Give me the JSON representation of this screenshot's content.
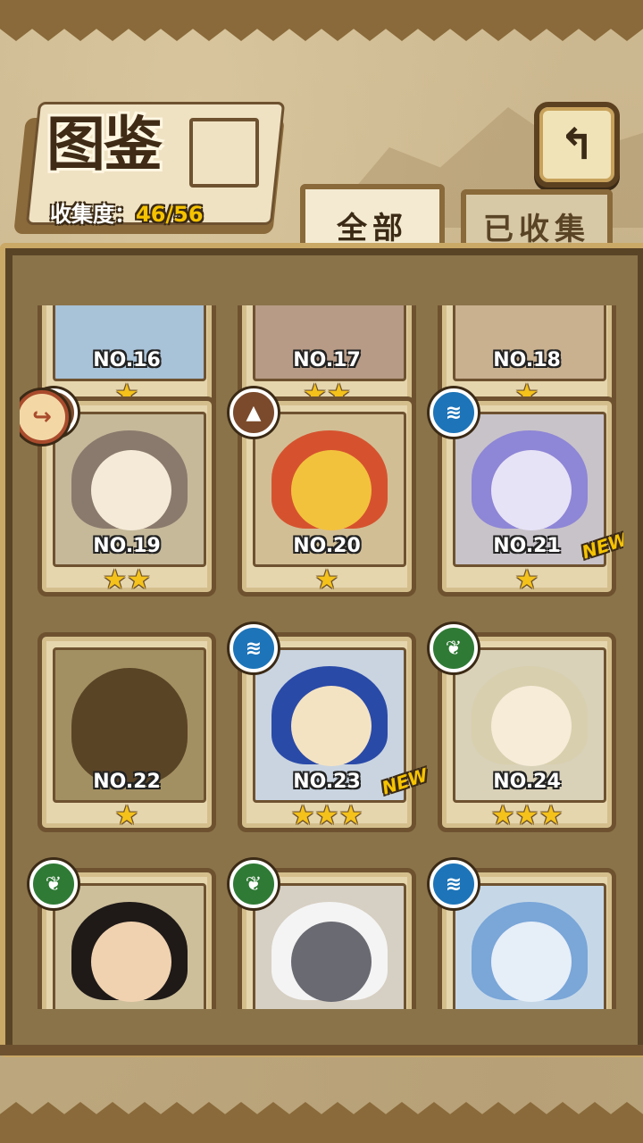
{
  "header": {
    "title": "图鉴",
    "collect_label": "收集度：",
    "collect_value": "46/56"
  },
  "back_button": {
    "icon": "return-arrow-icon",
    "glyph": "↰"
  },
  "tabs": [
    {
      "label": "全部",
      "active": true
    },
    {
      "label": "已收集",
      "active": false
    }
  ],
  "cards": [
    {
      "no": "NO.16",
      "stars": "★",
      "element": null
    },
    {
      "no": "NO.17",
      "stars": "★★",
      "element": null
    },
    {
      "no": "NO.18",
      "stars": "★",
      "element": null
    },
    {
      "no": "NO.19",
      "stars": "★★",
      "element": "earth",
      "element_glyph": "▲",
      "bookmark": "↪"
    },
    {
      "no": "NO.20",
      "stars": "★",
      "element": "earth",
      "element_glyph": "▲"
    },
    {
      "no": "NO.21",
      "stars": "★",
      "element": "water",
      "element_glyph": "≋",
      "new": "NEW"
    },
    {
      "no": "NO.22",
      "stars": "★",
      "element": null,
      "silhouette": true
    },
    {
      "no": "NO.23",
      "stars": "★★★",
      "element": "water",
      "element_glyph": "≋",
      "new": "NEW"
    },
    {
      "no": "NO.24",
      "stars": "★★★",
      "element": "leaf",
      "element_glyph": "❦"
    },
    {
      "element": "leaf",
      "element_glyph": "❦"
    },
    {
      "element": "leaf",
      "element_glyph": "❦"
    },
    {
      "element": "water",
      "element_glyph": "≋"
    }
  ],
  "colors": {
    "water": "#1d74b8",
    "leaf": "#2f7a35",
    "earth": "#7b4a2c",
    "star": "#f4c21a",
    "new_tag": "#f6c300"
  }
}
